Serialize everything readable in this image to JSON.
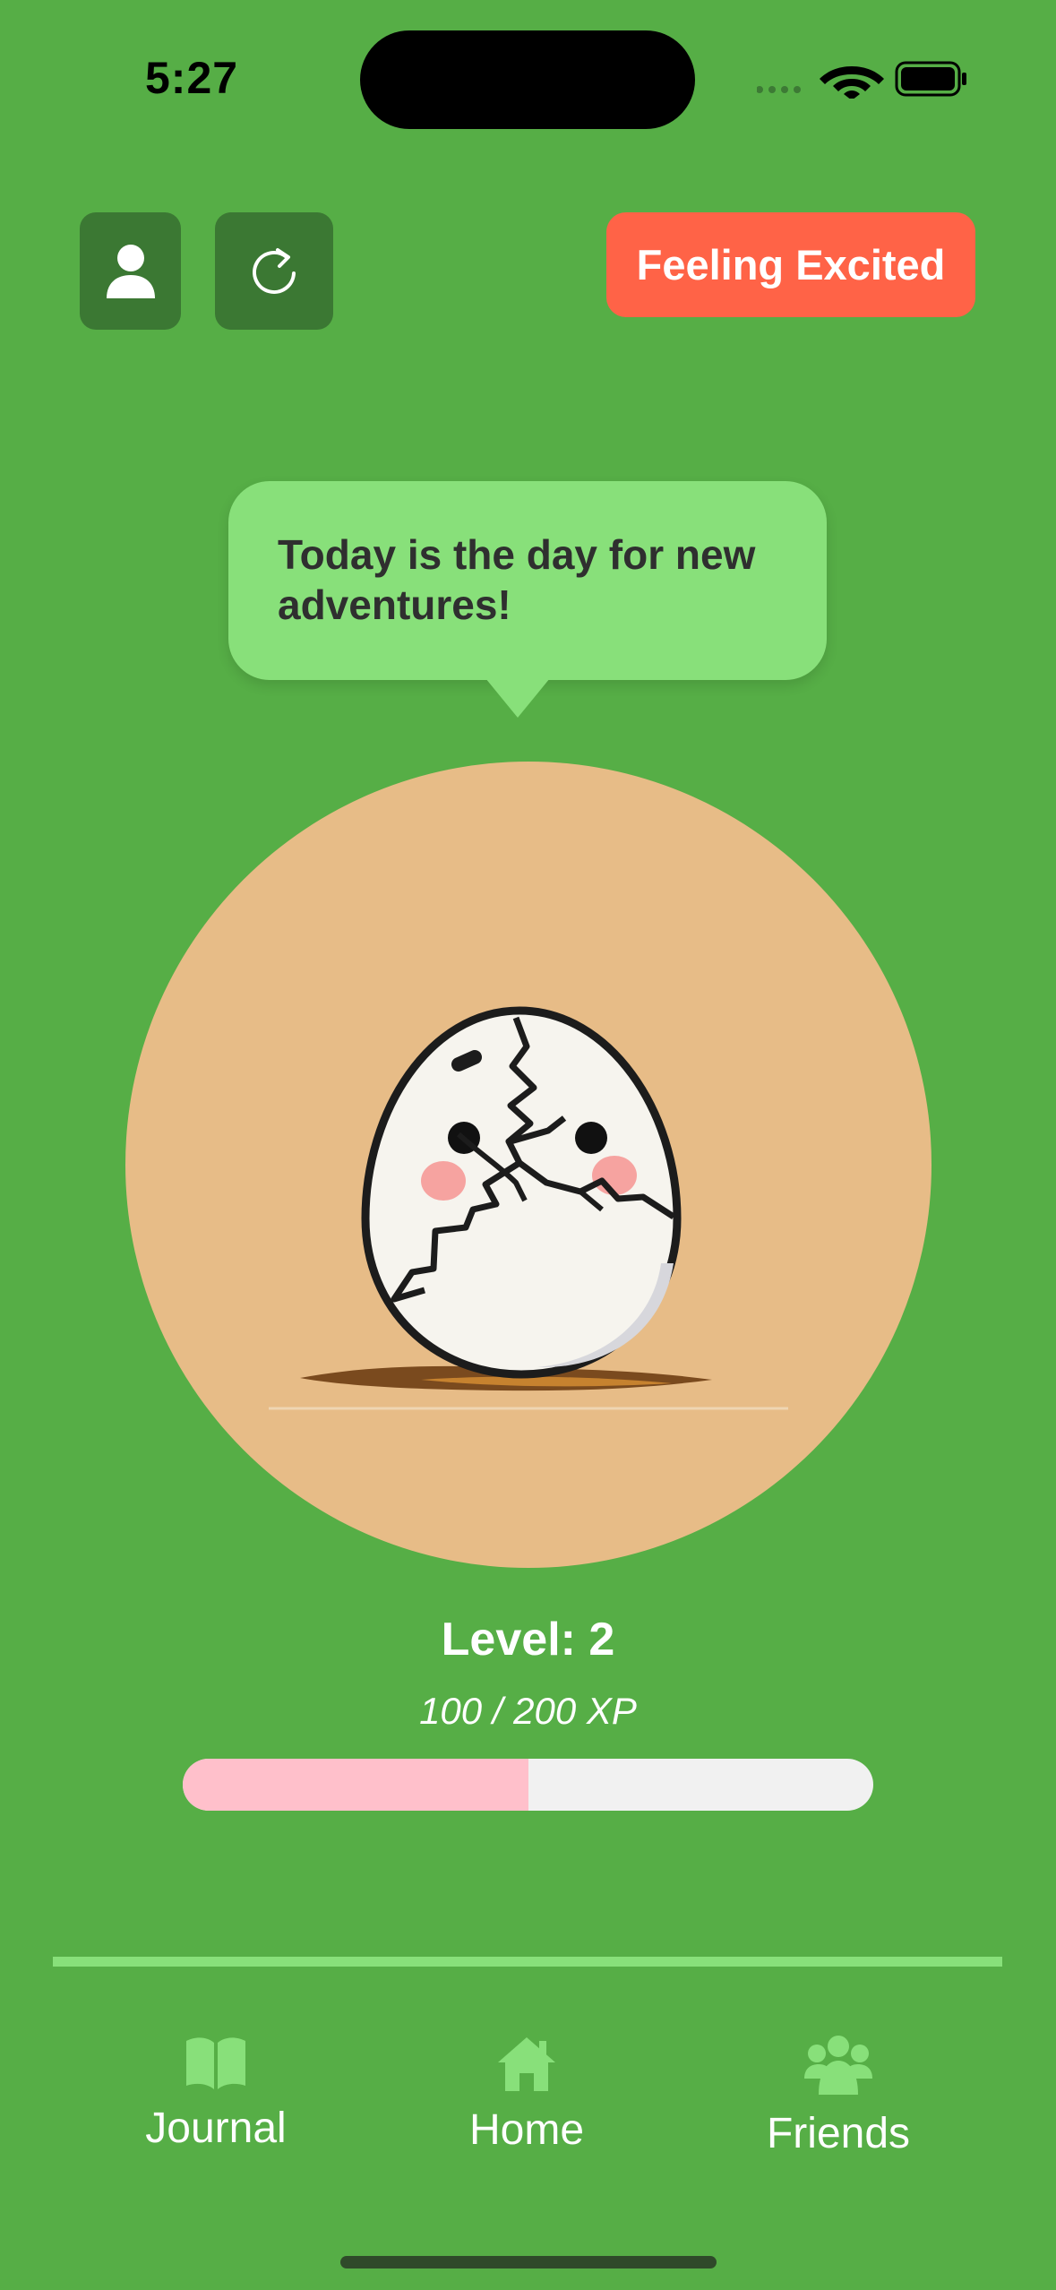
{
  "status_bar": {
    "time": "5:27"
  },
  "mood": {
    "label": "Feeling Excited",
    "color": "#ff6347"
  },
  "speech": {
    "text": "Today is the day for new adventures!"
  },
  "pet": {
    "name_icon": "cracked-egg-illustration",
    "background": "#e7bc87"
  },
  "level": {
    "label": "Level: 2",
    "xp_text": "100 / 200 XP",
    "progress": 0.5
  },
  "nav": {
    "items": [
      {
        "label": "Journal",
        "icon": "book-icon"
      },
      {
        "label": "Home",
        "icon": "house-icon"
      },
      {
        "label": "Friends",
        "icon": "people-icon"
      }
    ]
  },
  "colors": {
    "background": "#56ae46",
    "button_dark": "#3b7833",
    "accent_light": "#88e07a",
    "xp_fill": "#ffc0cb"
  }
}
